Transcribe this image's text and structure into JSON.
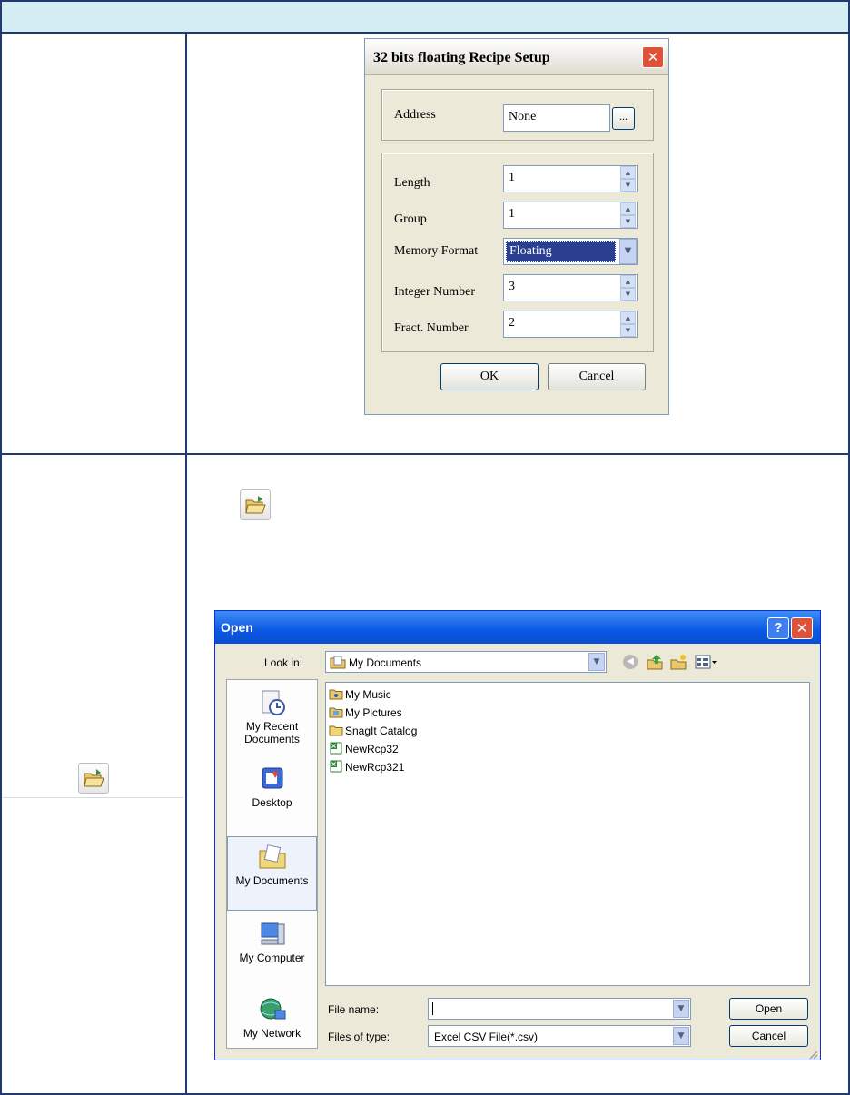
{
  "recipe_dialog": {
    "title": "32 bits floating Recipe Setup",
    "address_label": "Address",
    "address_value": "None",
    "browse_label": "...",
    "length_label": "Length",
    "length_value": "1",
    "group_label": "Group",
    "group_value": "1",
    "memory_format_label": "Memory Format",
    "memory_format_value": "Floating",
    "integer_number_label": "Integer Number",
    "integer_number_value": "3",
    "fract_number_label": "Fract. Number",
    "fract_number_value": "2",
    "ok_label": "OK",
    "cancel_label": "Cancel"
  },
  "open_dialog": {
    "title": "Open",
    "look_in_label": "Look in:",
    "look_in_value": "My Documents",
    "places": [
      {
        "label": "My Recent\nDocuments",
        "icon": "recent-documents-icon"
      },
      {
        "label": "Desktop",
        "icon": "desktop-icon"
      },
      {
        "label": "My Documents",
        "icon": "my-documents-icon"
      },
      {
        "label": "My Computer",
        "icon": "my-computer-icon"
      },
      {
        "label": "My Network",
        "icon": "my-network-icon"
      }
    ],
    "files": [
      {
        "name": "My Music",
        "icon": "folder-music-icon"
      },
      {
        "name": "My Pictures",
        "icon": "folder-pictures-icon"
      },
      {
        "name": "SnagIt Catalog",
        "icon": "folder-icon"
      },
      {
        "name": "NewRcp32",
        "icon": "csv-file-icon"
      },
      {
        "name": "NewRcp321",
        "icon": "csv-file-icon"
      }
    ],
    "file_name_label": "File name:",
    "file_name_value": "",
    "files_of_type_label": "Files of type:",
    "files_of_type_value": "Excel CSV File(*.csv)",
    "open_label": "Open",
    "cancel_label": "Cancel"
  },
  "icons": {
    "open_folder_toolbar": "open-folder-icon",
    "close": "close-icon",
    "help": "help-icon"
  }
}
